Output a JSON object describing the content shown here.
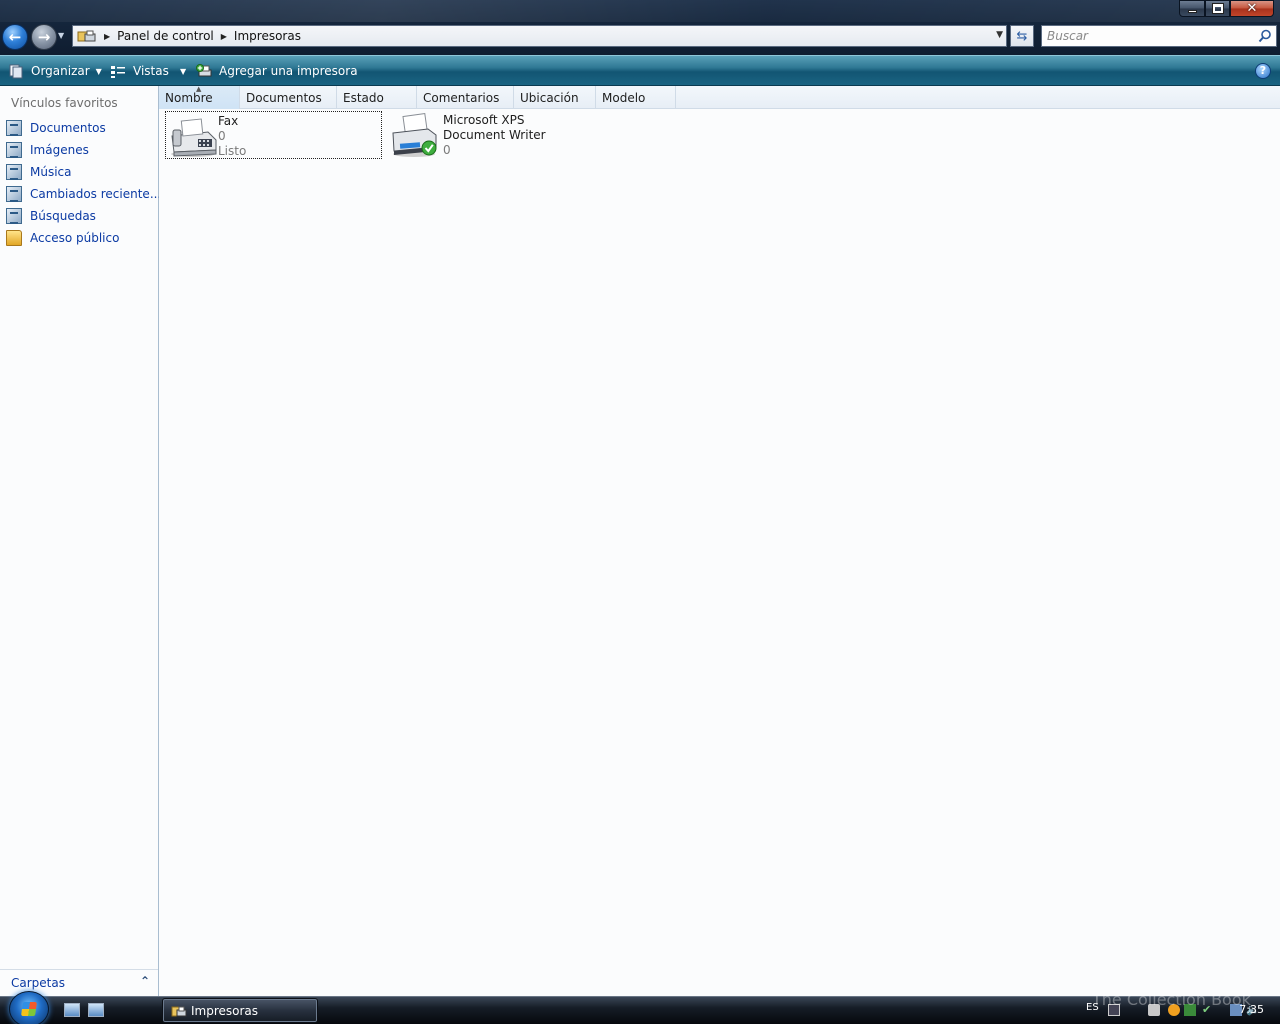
{
  "window": {
    "buttons": [
      "minimize",
      "maximize",
      "close"
    ]
  },
  "address": {
    "path": [
      "Panel de control",
      "Impresoras"
    ]
  },
  "search": {
    "placeholder": "Buscar"
  },
  "toolbar": {
    "organize_label": "Organizar",
    "views_label": "Vistas",
    "add_printer_label": "Agregar una impresora"
  },
  "navpane": {
    "title": "Vínculos favoritos",
    "items": [
      {
        "label": "Documentos",
        "icon": "documents-icon"
      },
      {
        "label": "Imágenes",
        "icon": "pictures-icon"
      },
      {
        "label": "Música",
        "icon": "music-icon"
      },
      {
        "label": "Cambiados reciente...",
        "icon": "recent-icon"
      },
      {
        "label": "Búsquedas",
        "icon": "searches-icon"
      },
      {
        "label": "Acceso público",
        "icon": "public-folder-icon"
      }
    ],
    "folders_label": "Carpetas"
  },
  "columns": [
    "Nombre",
    "Documentos",
    "Estado",
    "Comentarios",
    "Ubicación",
    "Modelo"
  ],
  "printers": [
    {
      "name": "Fax",
      "documents": "0",
      "status": "Listo",
      "selected": true,
      "default": false
    },
    {
      "name": "Microsoft XPS Document Writer",
      "documents": "0",
      "status": "",
      "selected": false,
      "default": true
    }
  ],
  "taskbar": {
    "task_label": "Impresoras",
    "language": "ES",
    "clock": "7:35"
  },
  "watermark": "The Collection Book",
  "colors": {
    "link": "#0b3aa3",
    "command_bar": "#1a6482",
    "title_band": "#14253b"
  }
}
